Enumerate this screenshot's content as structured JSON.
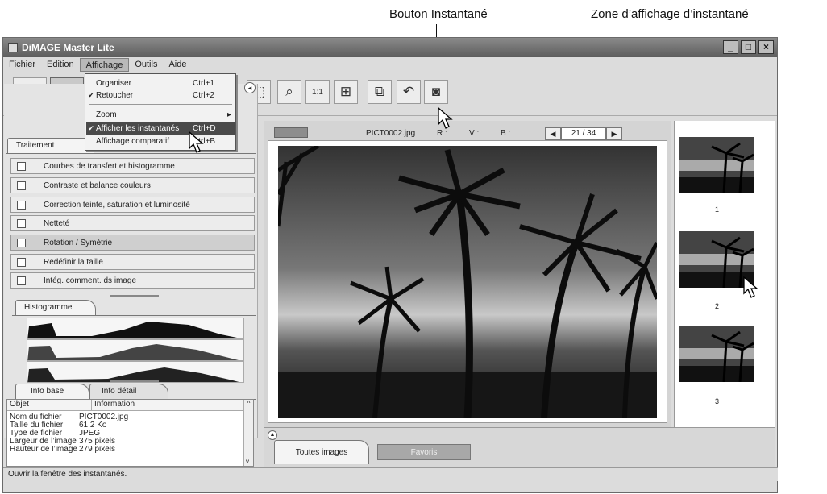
{
  "callouts": {
    "snapshot_button": "Bouton Instantané",
    "snapshot_area": "Zone d’affichage d’instantané"
  },
  "window": {
    "title": "DiMAGE Master Lite",
    "minimize": "_",
    "maximize": "□",
    "close": "×"
  },
  "menubar": [
    "Fichier",
    "Edition",
    "Affichage",
    "Outils",
    "Aide"
  ],
  "affichage_menu": [
    {
      "label": "Organiser",
      "shortcut": "Ctrl+1",
      "checked": ""
    },
    {
      "label": "Retoucher",
      "shortcut": "Ctrl+2",
      "checked": "✔"
    },
    {
      "label": "Zoom",
      "shortcut": "",
      "submenu": "▸"
    },
    {
      "label": "Afficher les instantanés",
      "shortcut": "Ctrl+D",
      "checked": "✔"
    },
    {
      "label": "Affichage comparatif",
      "shortcut": "Ctrl+B",
      "checked": ""
    }
  ],
  "left_panel": {
    "collapse_icon": "◂",
    "tab": "Traitement",
    "processes": [
      "Courbes de transfert et histogramme",
      "Contraste et balance couleurs",
      "Correction teinte, saturation et luminosité",
      "Netteté",
      "Rotation / Symétrie",
      "Redéfinir la taille",
      "Intég. comment. ds image"
    ],
    "histogram_tab": "Histogramme",
    "info_tabs": [
      "Info base",
      "Info détail"
    ],
    "info_headers": [
      "Objet",
      "Information"
    ],
    "info_rows": [
      [
        "Nom du fichier",
        "PICT0002.jpg"
      ],
      [
        "Taille du fichier",
        "61,2 Ko"
      ],
      [
        "Type de fichier",
        "JPEG"
      ],
      [
        "Largeur de l’image",
        "375 pixels"
      ],
      [
        "Hauteur de l’image",
        "279 pixels"
      ]
    ]
  },
  "viewer": {
    "filename": "PICT0002.jpg",
    "r_label": "R :",
    "v_label": "V :",
    "b_label": "B :",
    "counter": "21 / 34",
    "prev": "◀",
    "next": "▶"
  },
  "snapshots": [
    "1",
    "2",
    "3"
  ],
  "bottom_tabs": [
    "Toutes images",
    "Favoris"
  ],
  "status": "Ouvrir la fenêtre des instantanés."
}
